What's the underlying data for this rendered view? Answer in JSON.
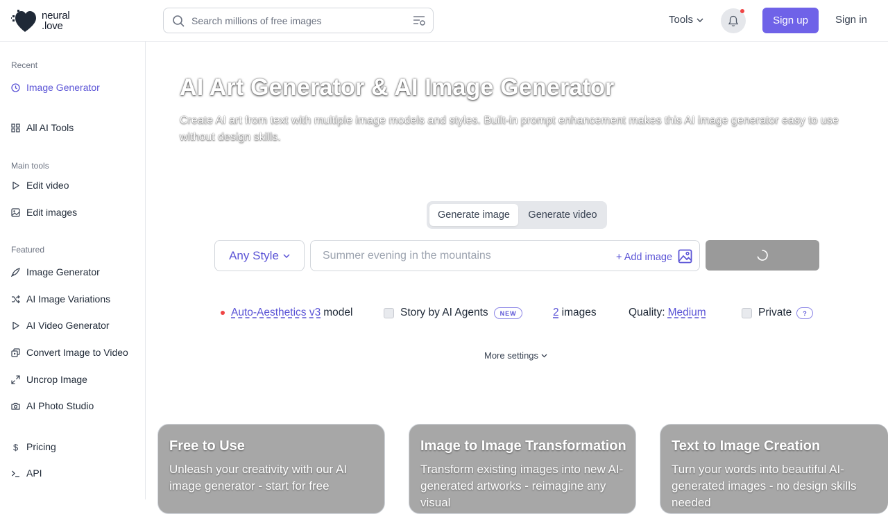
{
  "header": {
    "logo_line1": "neural",
    "logo_line2": ".love",
    "search_placeholder": "Search millions of free images",
    "tools_label": "Tools",
    "signup_label": "Sign up",
    "signin_label": "Sign in"
  },
  "sidebar": {
    "recent_heading": "Recent",
    "recent_item": "Image Generator",
    "all_tools": "All AI Tools",
    "main_heading": "Main tools",
    "main_items": [
      "Edit video",
      "Edit images"
    ],
    "featured_heading": "Featured",
    "featured_items": [
      "Image Generator",
      "AI Image Variations",
      "AI Video Generator",
      "Convert Image to Video",
      "Uncrop Image",
      "AI Photo Studio"
    ],
    "bottom_items": [
      "Pricing",
      "API"
    ]
  },
  "hero": {
    "title": "AI Art Generator & AI Image Generator",
    "subtitle": "Create AI art from text with multiple image models and styles. Built-in prompt enhancement makes this AI image generator easy to use without design skills."
  },
  "mode_tabs": [
    "Generate image",
    "Generate video"
  ],
  "generator": {
    "style_label": "Any Style",
    "prompt_placeholder": "Summer evening in the mountains",
    "add_image_label": "+ Add image"
  },
  "options": {
    "model_name": "Auto-Aesthetics v3",
    "model_suffix": "model",
    "story_label": "Story by AI Agents",
    "new_badge": "NEW",
    "image_count": "2",
    "images_label": "images",
    "quality_label": "Quality:",
    "quality_value": "Medium",
    "private_label": "Private",
    "help_badge": "?",
    "more_settings": "More settings"
  },
  "cards": [
    {
      "title": "Free to Use",
      "desc": "Unleash your creativity with our AI image generator - start for free"
    },
    {
      "title": "Image to Image Transformation",
      "desc": "Transform existing images into new AI-generated artworks - reimagine any visual"
    },
    {
      "title": "Text to Image Creation",
      "desc": "Turn your words into beautiful AI-generated images - no design skills needed"
    }
  ],
  "colors": {
    "accent": "#6f62e8",
    "link": "#5b54d6",
    "notification_dot": "#ef4444"
  }
}
